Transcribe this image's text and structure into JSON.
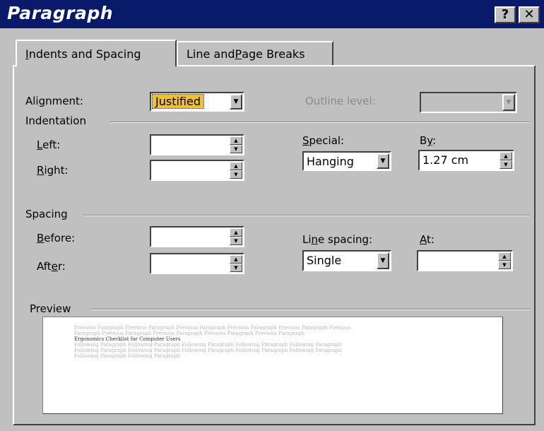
{
  "window": {
    "title": "Paragraph",
    "help_label": "?",
    "close_label": "✕"
  },
  "tabs": [
    {
      "pre": "",
      "u": "I",
      "post": "ndents and Spacing",
      "active": true
    },
    {
      "pre": "Line and ",
      "u": "P",
      "post": "age Breaks",
      "active": false
    }
  ],
  "alignment": {
    "pre": "Ali",
    "u": "g",
    "post": "nment:",
    "value": "Justified"
  },
  "outline_level": {
    "label": "Outline level:",
    "value": ""
  },
  "indentation": {
    "title": "Indentation",
    "left": {
      "u": "L",
      "post": "eft:",
      "value": ""
    },
    "right": {
      "u": "R",
      "post": "ight:",
      "value": ""
    },
    "special": {
      "u": "S",
      "post": "pecial:",
      "value": "Hanging"
    },
    "by": {
      "pre": "B",
      "u": "y",
      "post": ":",
      "value": "1.27 cm"
    }
  },
  "spacing": {
    "title": "Spacing",
    "before": {
      "u": "B",
      "post": "efore:",
      "value": ""
    },
    "after": {
      "pre": "Aft",
      "u": "e",
      "post": "r:",
      "value": ""
    },
    "line_spacing": {
      "pre": "Li",
      "u": "n",
      "post": "e spacing:",
      "value": "Single"
    },
    "at": {
      "u": "A",
      "post": "t:",
      "value": ""
    }
  },
  "preview": {
    "title": "Preview",
    "lines": [
      {
        "text": "Previous Paragraph Previous Paragraph Previous Paragraph Previous Paragraph Previous Paragraph Previous",
        "dark": false
      },
      {
        "text": "Paragraph Previous Paragraph Previous Paragraph Previous Paragraph Previous Paragraph",
        "dark": false
      },
      {
        "text": "Ergonomics Checklist for Computer Users",
        "dark": true
      },
      {
        "text": "Following Paragraph Following Paragraph Following Paragraph Following Paragraph Following Paragraph",
        "dark": false
      },
      {
        "text": "Following Paragraph Following Paragraph Following Paragraph Following Paragraph Following Paragraph",
        "dark": false
      },
      {
        "text": "Following Paragraph Following Paragraph",
        "dark": false
      }
    ]
  },
  "colors": {
    "titlebar": "#0a1a6a",
    "face": "#c0c0c0",
    "selection": "#f0c030"
  }
}
